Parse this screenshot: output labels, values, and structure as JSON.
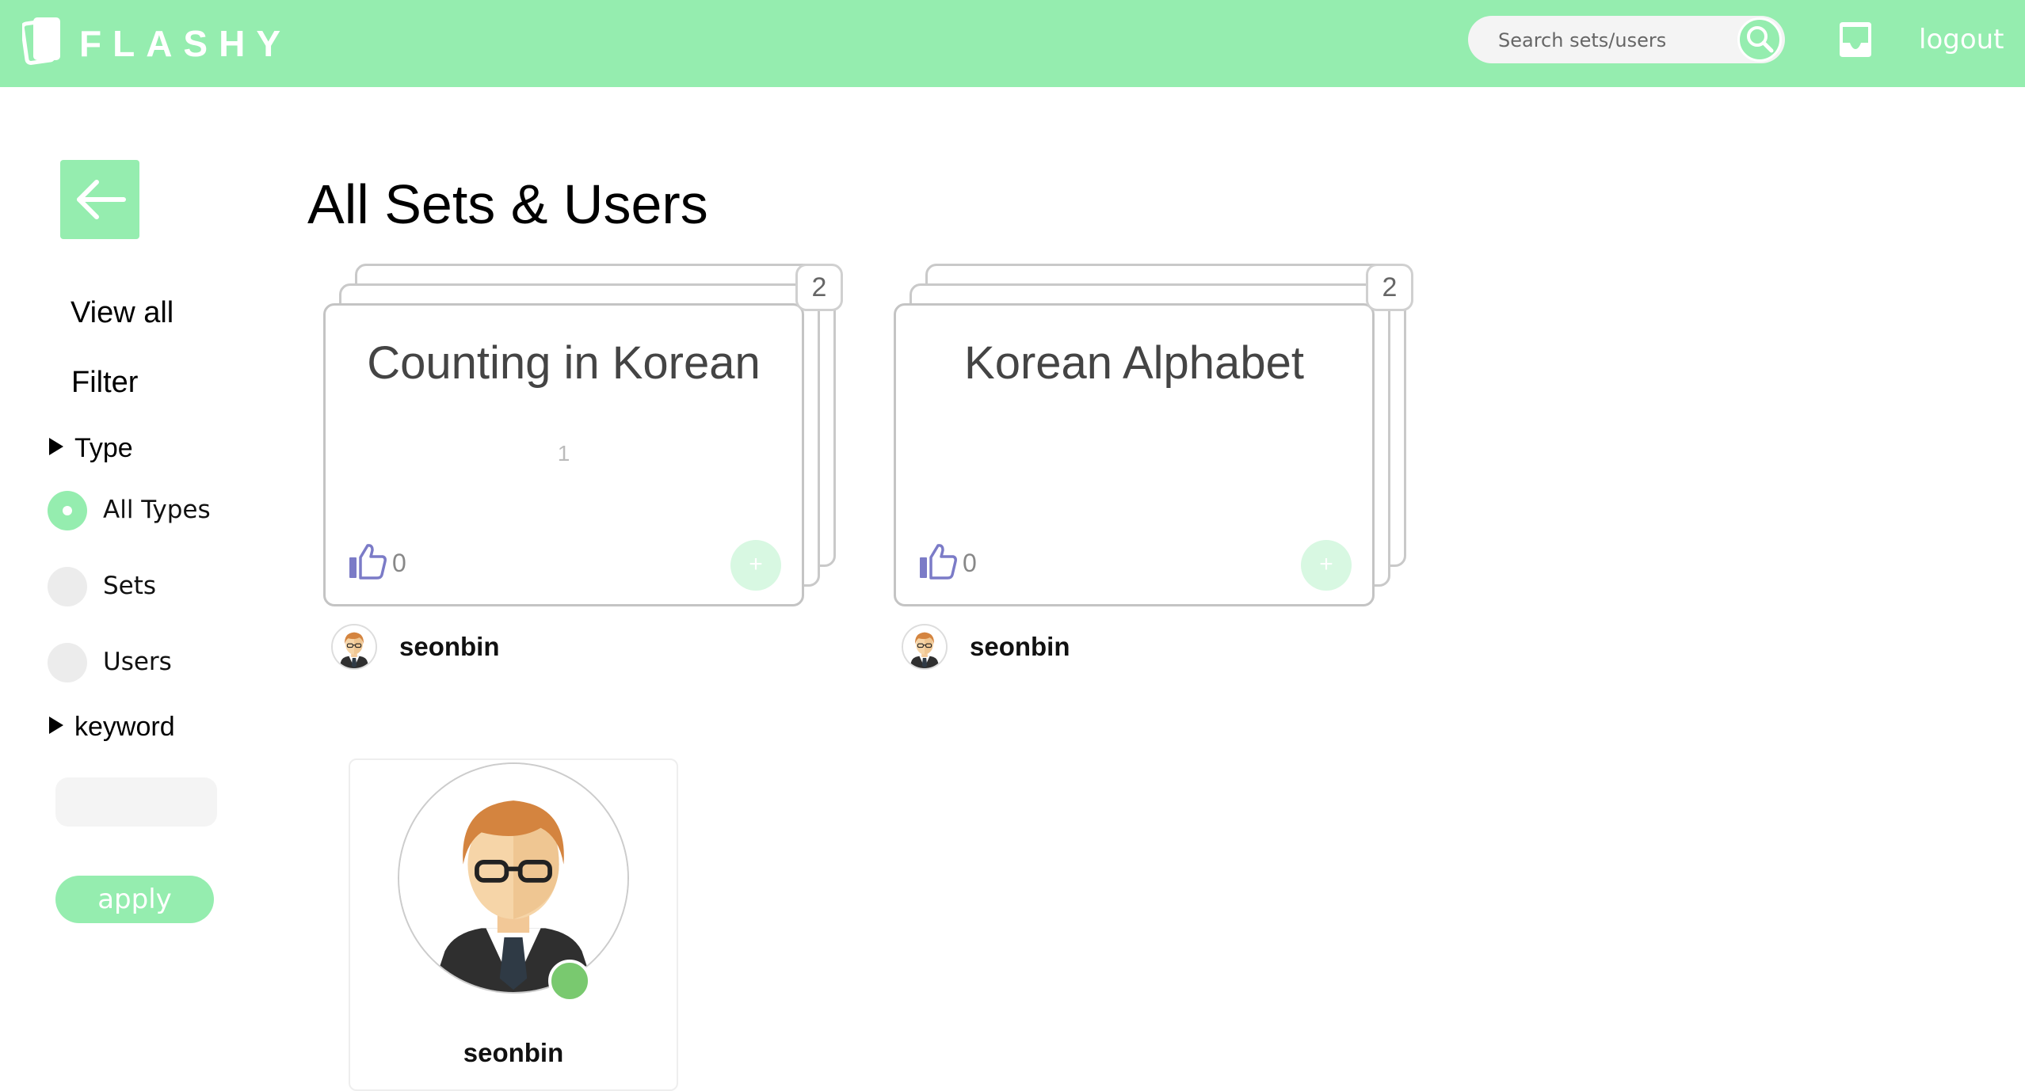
{
  "brand": {
    "name": "FLASHY",
    "accent": "#95edaf"
  },
  "header": {
    "search": {
      "placeholder": "Search sets/users"
    },
    "logout_label": "logout",
    "icons": {
      "logo": "cards-logo-icon",
      "search": "search-icon",
      "inbox": "inbox-icon"
    }
  },
  "sidebar": {
    "back_icon": "arrow-left-icon",
    "view_all": "View all",
    "filter": "Filter",
    "type_section": "Type",
    "type_options": [
      {
        "label": "All Types",
        "selected": true
      },
      {
        "label": "Sets",
        "selected": false
      },
      {
        "label": "Users",
        "selected": false
      }
    ],
    "keyword_section": "keyword",
    "keyword_value": "",
    "apply_label": "apply"
  },
  "main": {
    "title": "All Sets & Users",
    "sets": [
      {
        "title": "Counting in Korean",
        "description": "1",
        "card_count": "2",
        "likes": "0",
        "add_label": "+",
        "owner": "seonbin"
      },
      {
        "title": "Korean Alphabet",
        "description": "",
        "card_count": "2",
        "likes": "0",
        "add_label": "+",
        "owner": "seonbin"
      }
    ],
    "users": [
      {
        "name": "seonbin",
        "online": true,
        "status_color": "#79c96f"
      }
    ]
  }
}
